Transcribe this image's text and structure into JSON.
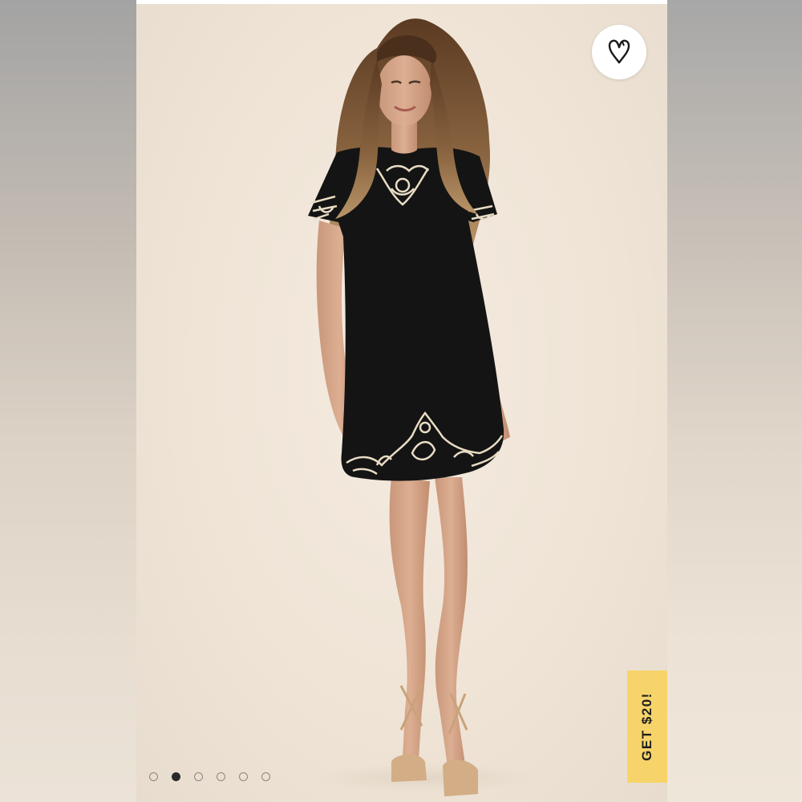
{
  "gallery": {
    "image_index": 2,
    "image_count": 6,
    "dots": [
      {
        "active": false
      },
      {
        "active": true
      },
      {
        "active": false
      },
      {
        "active": false
      },
      {
        "active": false
      },
      {
        "active": false
      }
    ]
  },
  "favorite": {
    "icon": "heart-outline-icon"
  },
  "promo": {
    "label": "GET $20!",
    "color": "#f7d46a"
  },
  "product_photo": {
    "subject": "model-wearing-black-embroidered-shift-dress",
    "dress_color": "#141414",
    "embroidery_color": "#e8dcc4"
  }
}
